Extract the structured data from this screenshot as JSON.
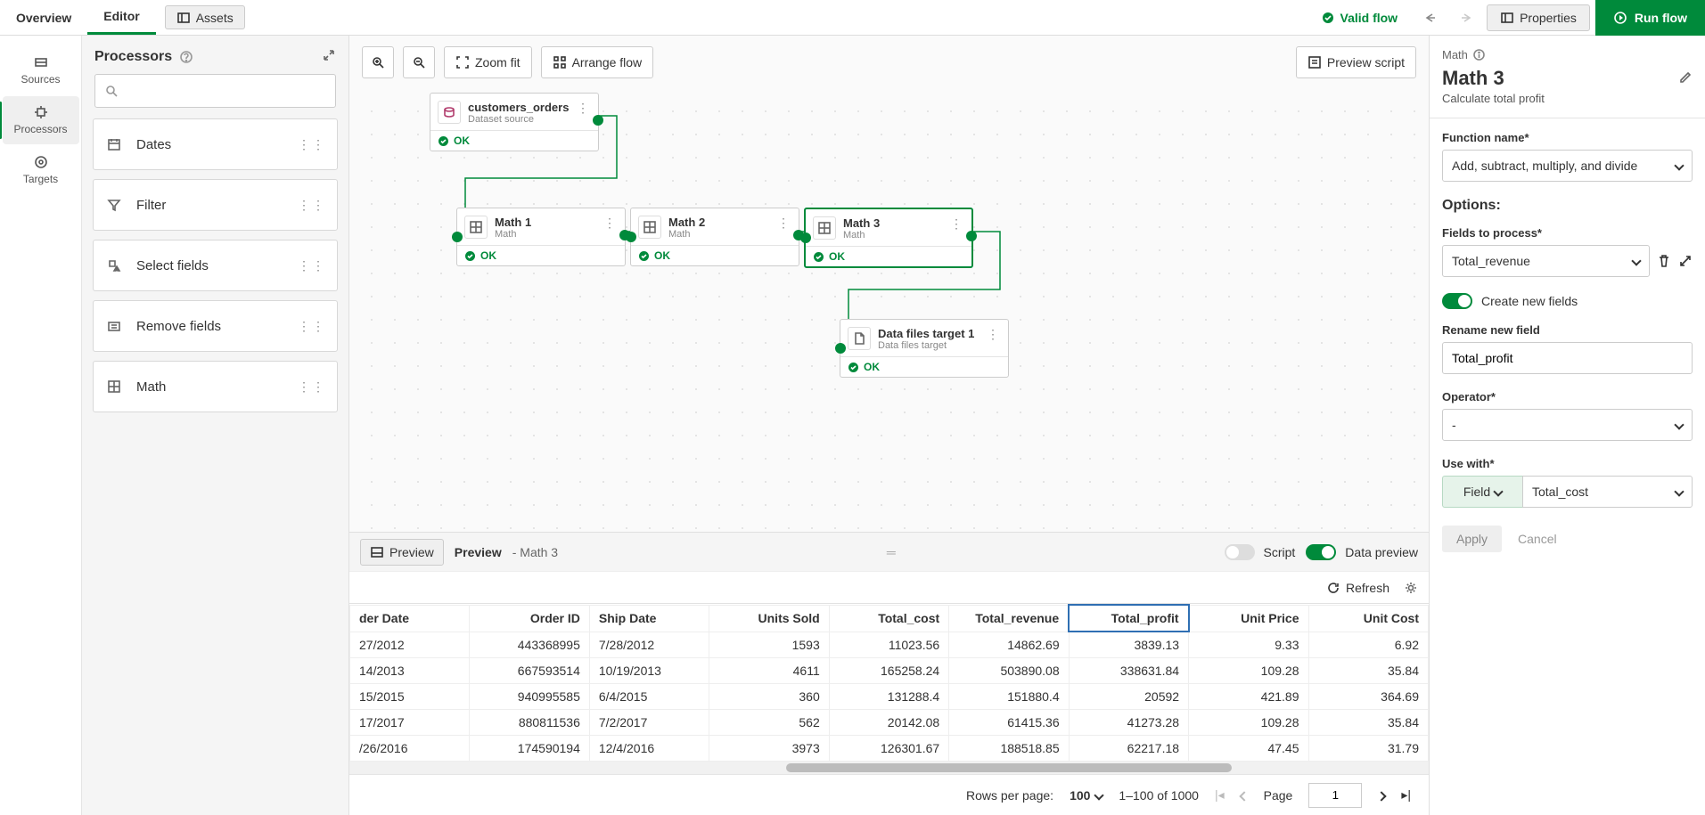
{
  "topbar": {
    "tabs": [
      "Overview",
      "Editor"
    ],
    "active_tab": 1,
    "assets": "Assets",
    "valid": "Valid flow",
    "properties": "Properties",
    "run": "Run flow"
  },
  "leftnav": {
    "items": [
      {
        "label": "Sources"
      },
      {
        "label": "Processors"
      },
      {
        "label": "Targets"
      }
    ],
    "active": 1
  },
  "processors_panel": {
    "title": "Processors",
    "search_placeholder": "",
    "items": [
      {
        "label": "Dates",
        "icon": "calendar"
      },
      {
        "label": "Filter",
        "icon": "filter"
      },
      {
        "label": "Select fields",
        "icon": "select"
      },
      {
        "label": "Remove fields",
        "icon": "remove"
      },
      {
        "label": "Math",
        "icon": "math"
      }
    ]
  },
  "canvas_toolbar": {
    "zoom_fit": "Zoom fit",
    "arrange": "Arrange flow",
    "preview_script": "Preview script"
  },
  "nodes": {
    "source": {
      "title": "customers_orders",
      "sub": "Dataset source",
      "status": "OK"
    },
    "math1": {
      "title": "Math 1",
      "sub": "Math",
      "status": "OK"
    },
    "math2": {
      "title": "Math 2",
      "sub": "Math",
      "status": "OK"
    },
    "math3": {
      "title": "Math 3",
      "sub": "Math",
      "status": "OK"
    },
    "target": {
      "title": "Data files target 1",
      "sub": "Data files target",
      "status": "OK"
    }
  },
  "right": {
    "breadcrumb": "Math",
    "title": "Math 3",
    "subtitle": "Calculate total profit",
    "function_label": "Function name*",
    "function_value": "Add, subtract, multiply, and divide",
    "options": "Options:",
    "fields_label": "Fields to process*",
    "fields_value": "Total_revenue",
    "create_new": "Create new fields",
    "rename_label": "Rename new field",
    "rename_value": "Total_profit",
    "operator_label": "Operator*",
    "operator_value": "-",
    "usewith_label": "Use with*",
    "usewith_type": "Field",
    "usewith_value": "Total_cost",
    "apply": "Apply",
    "cancel": "Cancel"
  },
  "preview_bar": {
    "chip": "Preview",
    "title": "Preview",
    "subtitle": "- Math 3",
    "script": "Script",
    "datapreview": "Data preview"
  },
  "preview_toolbar": {
    "refresh": "Refresh"
  },
  "table": {
    "columns": [
      "der Date",
      "Order ID",
      "Ship Date",
      "Units Sold",
      "Total_cost",
      "Total_revenue",
      "Total_profit",
      "Unit Price",
      "Unit Cost"
    ],
    "highlight_col": 6,
    "rows": [
      [
        "27/2012",
        "443368995",
        "7/28/2012",
        "1593",
        "11023.56",
        "14862.69",
        "3839.13",
        "9.33",
        "6.92"
      ],
      [
        "14/2013",
        "667593514",
        "10/19/2013",
        "4611",
        "165258.24",
        "503890.08",
        "338631.84",
        "109.28",
        "35.84"
      ],
      [
        "15/2015",
        "940995585",
        "6/4/2015",
        "360",
        "131288.4",
        "151880.4",
        "20592",
        "421.89",
        "364.69"
      ],
      [
        "17/2017",
        "880811536",
        "7/2/2017",
        "562",
        "20142.08",
        "61415.36",
        "41273.28",
        "109.28",
        "35.84"
      ],
      [
        "/26/2016",
        "174590194",
        "12/4/2016",
        "3973",
        "126301.67",
        "188518.85",
        "62217.18",
        "47.45",
        "31.79"
      ]
    ],
    "numcols": [
      1,
      3,
      4,
      5,
      6,
      7,
      8
    ]
  },
  "pager": {
    "rpp_label": "Rows per page:",
    "rpp_value": "100",
    "range": "1–100 of 1000",
    "page_label": "Page",
    "page_value": "1"
  }
}
